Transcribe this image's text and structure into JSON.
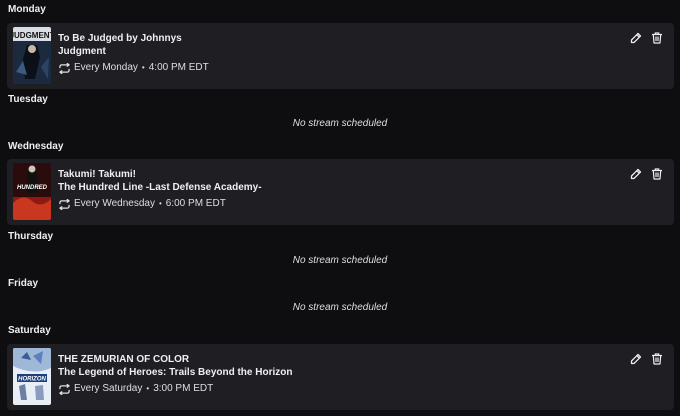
{
  "days": {
    "monday": "Monday",
    "tuesday": "Tuesday",
    "wednesday": "Wednesday",
    "thursday": "Thursday",
    "friday": "Friday",
    "saturday": "Saturday"
  },
  "empty_text": "No stream scheduled",
  "streams": [
    {
      "line1": "To Be Judged by Johnnys",
      "line2": "Judgment",
      "recurrence": "Every Monday",
      "time": "4:00 PM EDT",
      "thumbnail_text": "JUDGMENT"
    },
    {
      "line1": "Takumi! Takumi!",
      "line2": "The Hundred Line -Last Defense Academy-",
      "recurrence": "Every Wednesday",
      "time": "6:00 PM EDT",
      "thumbnail_text": "HUNDRED"
    },
    {
      "line1": "THE ZEMURIAN OF COLOR",
      "line2": "The Legend of Heroes: Trails Beyond the Horizon",
      "recurrence": "Every Saturday",
      "time": "3:00 PM EDT",
      "thumbnail_text": "HORIZON"
    }
  ],
  "separator": "•",
  "icons": {
    "recurrence": "repeat-icon",
    "edit": "pencil-icon",
    "delete": "trash-icon"
  }
}
